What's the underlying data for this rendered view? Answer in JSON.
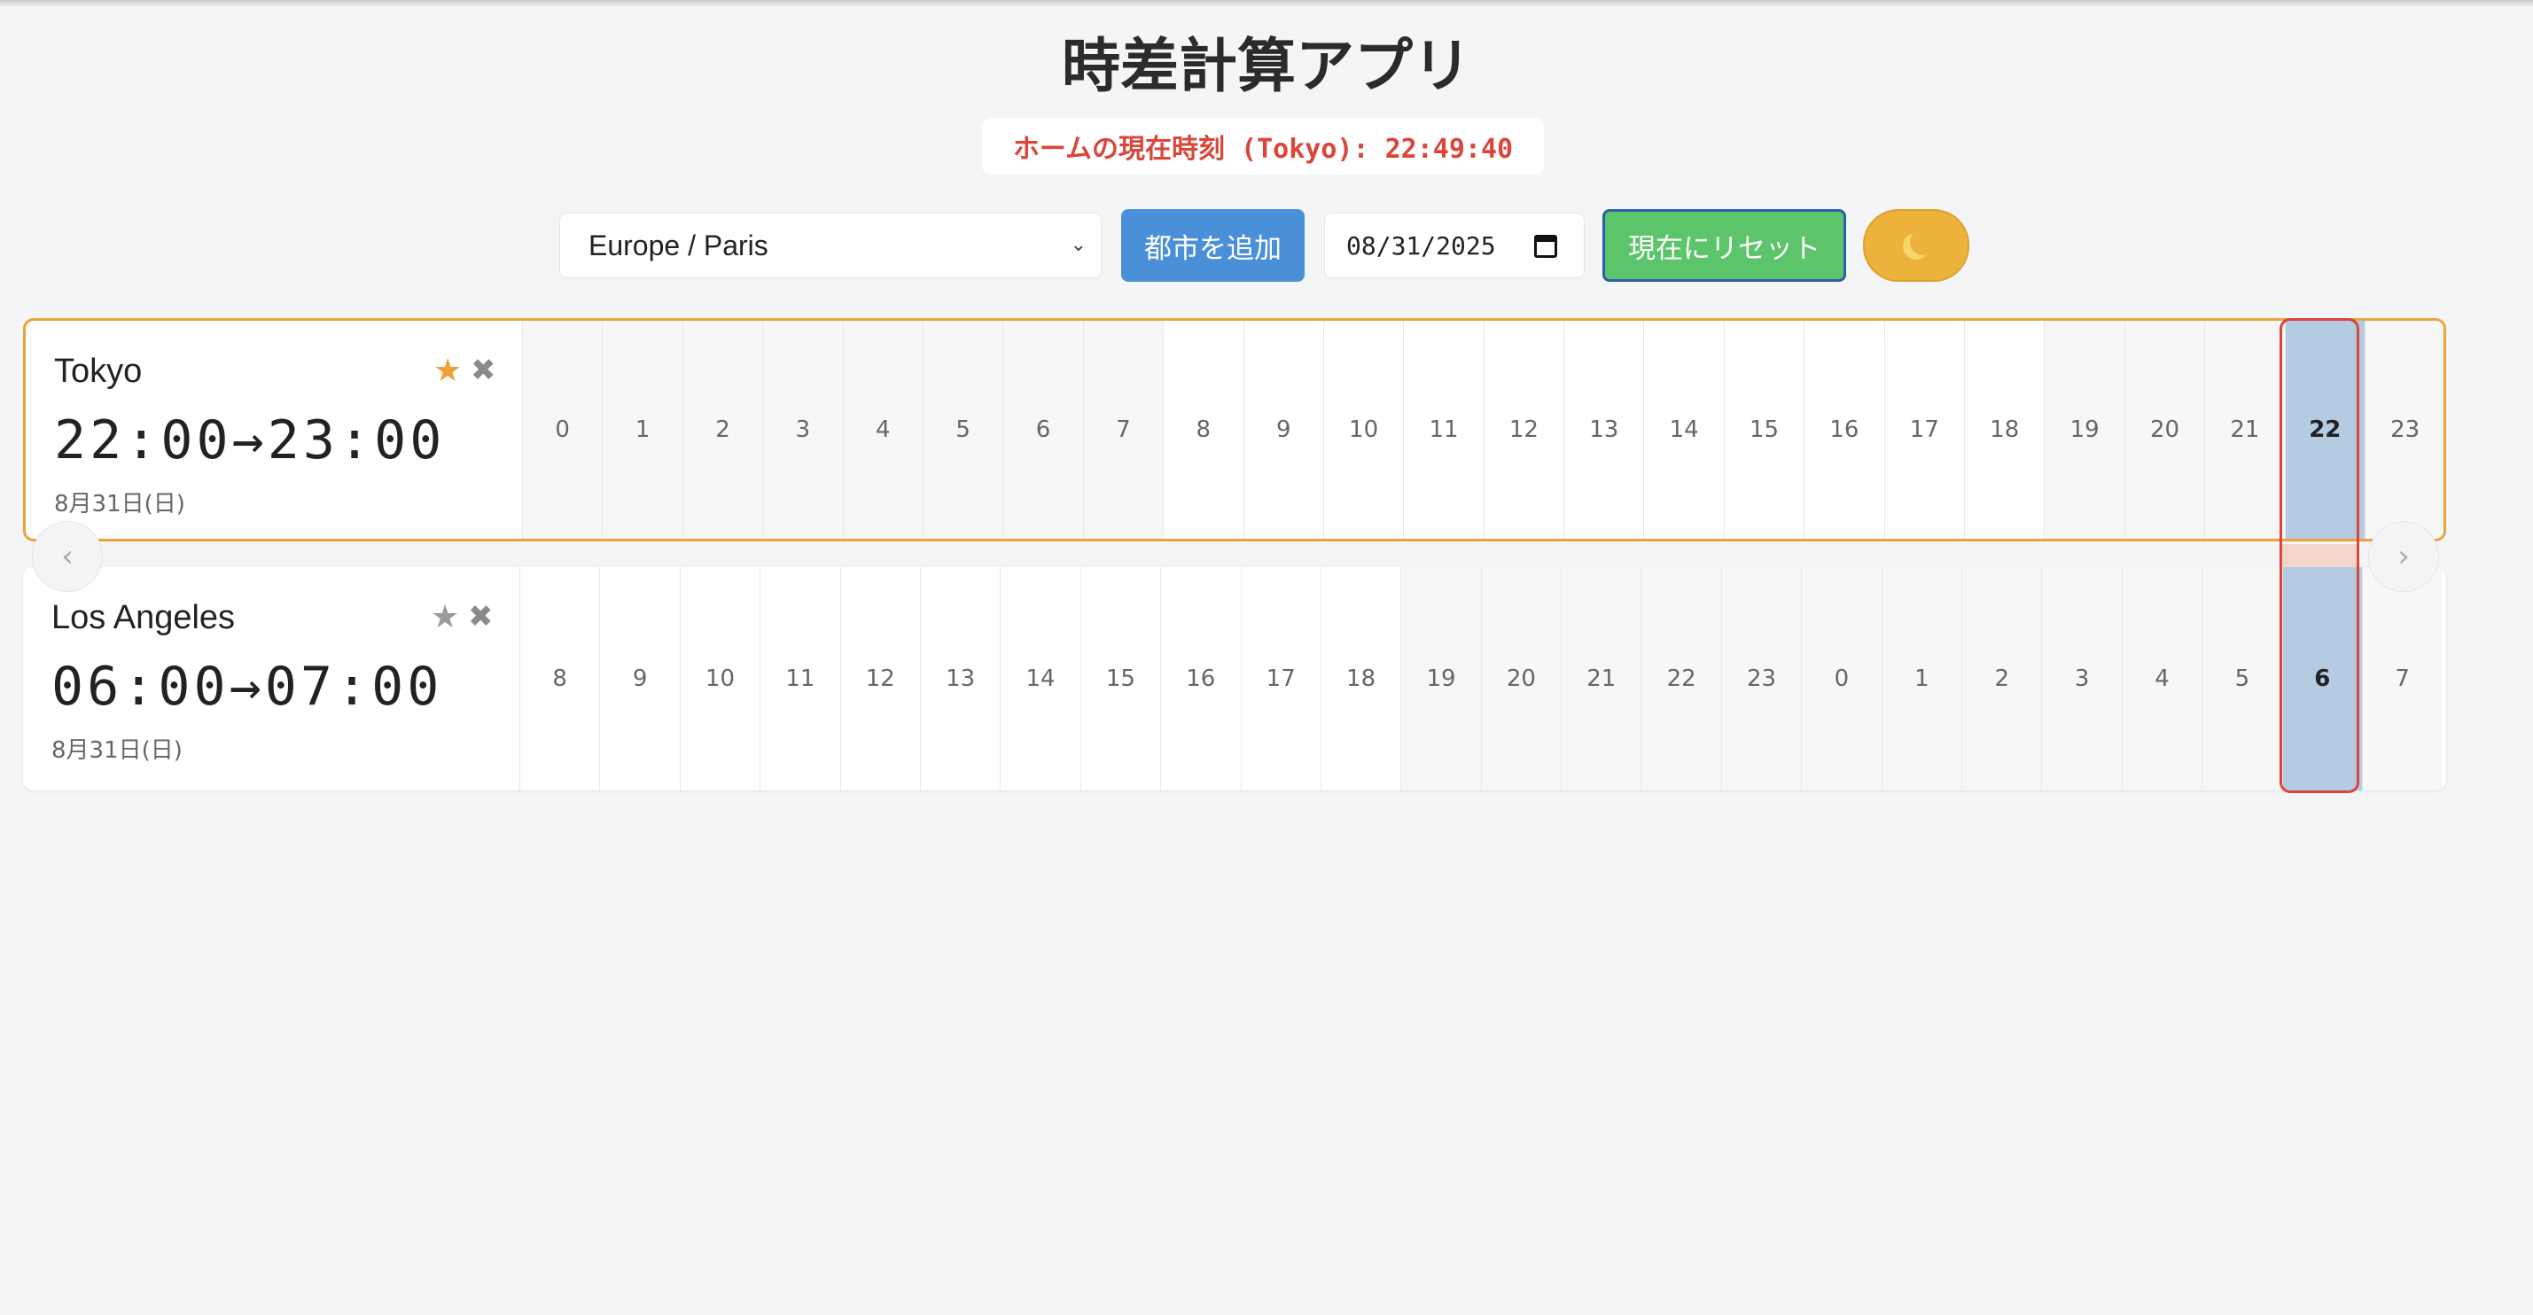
{
  "app": {
    "title": "時差計算アプリ"
  },
  "clock": {
    "label": "ホームの現在時刻 (Tokyo): 22:49:40"
  },
  "controls": {
    "timezone_selected": "Europe / Paris",
    "add_city_label": "都市を追加",
    "date_value": "08/31/2025",
    "reset_label": "現在にリセット",
    "theme_icon": "moon-icon"
  },
  "cities": [
    {
      "name": "Tokyo",
      "time_range": "22:00→23:00",
      "date": "8月31日(日)",
      "favorite": true,
      "hours": [
        "0",
        "1",
        "2",
        "3",
        "4",
        "5",
        "6",
        "7",
        "8",
        "9",
        "10",
        "11",
        "12",
        "13",
        "14",
        "15",
        "16",
        "17",
        "18",
        "19",
        "20",
        "21",
        "22",
        "23"
      ],
      "selected_hour": "22"
    },
    {
      "name": "Los Angeles",
      "time_range": "06:00→07:00",
      "date": "8月31日(日)",
      "favorite": false,
      "hours": [
        "8",
        "9",
        "10",
        "11",
        "12",
        "13",
        "14",
        "15",
        "16",
        "17",
        "18",
        "19",
        "20",
        "21",
        "22",
        "23",
        "0",
        "1",
        "2",
        "3",
        "4",
        "5",
        "6",
        "7"
      ],
      "selected_hour": "6"
    }
  ],
  "icons": {
    "favorite": "★",
    "remove": "✖",
    "prev": "‹",
    "next": "›"
  },
  "colors": {
    "accent_home_border": "#eca238",
    "selection_border": "#d9463a",
    "selected_cell": "#b4cbe2",
    "add_button": "#4a90d9",
    "reset_button": "#5cc46b",
    "clock_text": "#d9463a"
  }
}
